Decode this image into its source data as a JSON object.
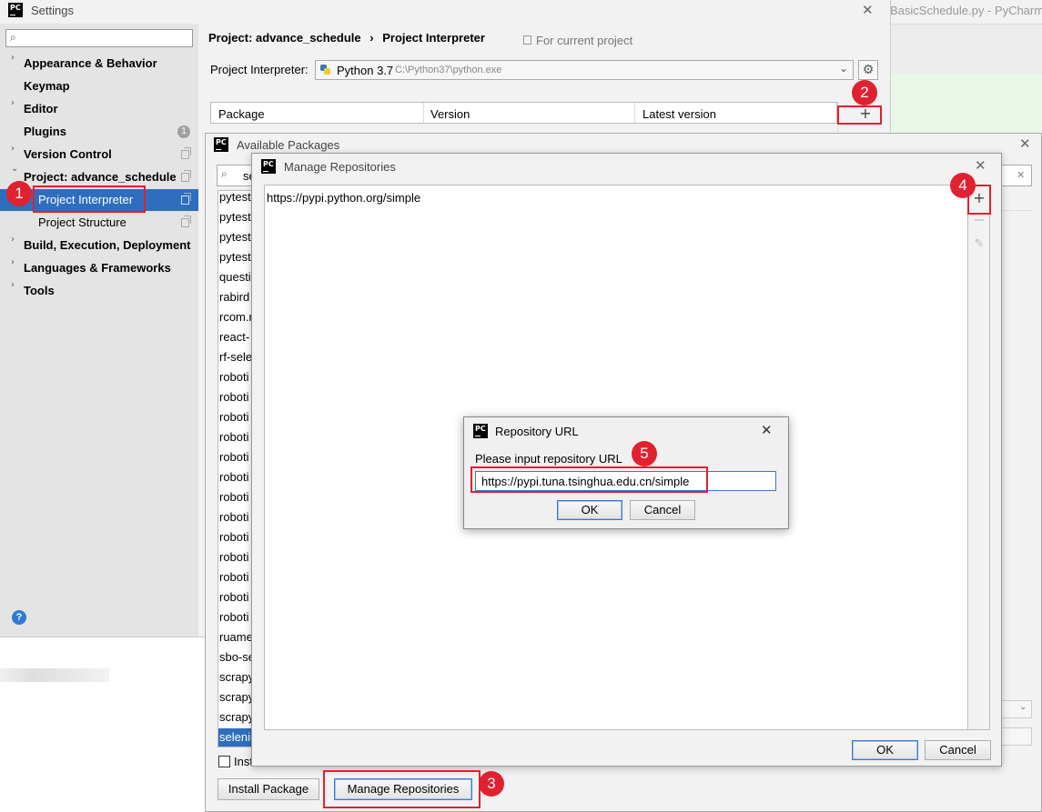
{
  "pycharm_bg": {
    "title": "BasicSchedule.py - PyCharm"
  },
  "settings": {
    "title": "Settings",
    "breadcrumb_project": "Project: advance_schedule",
    "breadcrumb_sep": "›",
    "breadcrumb_page": "Project Interpreter",
    "for_current_project": "For current project",
    "interpreter_label": "Project Interpreter:",
    "interpreter_name": "Python 3.7",
    "interpreter_path": "C:\\Python37\\python.exe",
    "table_headers": [
      "Package",
      "Version",
      "Latest version"
    ],
    "plugins_count": "1",
    "sidebar": [
      {
        "label": "Appearance & Behavior",
        "arrow": "›",
        "bold": true
      },
      {
        "label": "Keymap",
        "arrow": "",
        "bold": true
      },
      {
        "label": "Editor",
        "arrow": "›",
        "bold": true
      },
      {
        "label": "Plugins",
        "arrow": "",
        "bold": true
      },
      {
        "label": "Version Control",
        "arrow": "›",
        "bold": true
      },
      {
        "label": "Project: advance_schedule",
        "arrow": "⌄",
        "bold": true
      },
      {
        "label": "Project Interpreter",
        "arrow": "",
        "bold": false
      },
      {
        "label": "Project Structure",
        "arrow": "",
        "bold": false
      },
      {
        "label": "Build, Execution, Deployment",
        "arrow": "›",
        "bold": true
      },
      {
        "label": "Languages & Frameworks",
        "arrow": "›",
        "bold": true
      },
      {
        "label": "Tools",
        "arrow": "›",
        "bold": true
      }
    ]
  },
  "available_packages": {
    "title": "Available Packages",
    "search_value": "se",
    "packages": [
      "pytest",
      "pytest",
      "pytest",
      "pytest",
      "questi",
      "rabird",
      "rcom.r",
      "react-",
      "rf-sele",
      "roboti",
      "roboti",
      "roboti",
      "roboti",
      "roboti",
      "roboti",
      "roboti",
      "roboti",
      "roboti",
      "roboti",
      "roboti",
      "roboti",
      "roboti",
      "ruame",
      "sbo-se",
      "scrapy",
      "scrapy",
      "scrapy",
      "seleniu"
    ],
    "install_checkbox_label": "Inst",
    "install_button": "Install Package",
    "manage_button": "Manage Repositories"
  },
  "manage_repos": {
    "title": "Manage Repositories",
    "repos": [
      "https://pypi.python.org/simple"
    ],
    "ok": "OK",
    "cancel": "Cancel"
  },
  "repo_url": {
    "title": "Repository URL",
    "prompt": "Please input repository URL",
    "value": "https://pypi.tuna.tsinghua.edu.cn/simple",
    "ok": "OK",
    "cancel": "Cancel"
  },
  "markers": [
    "1",
    "2",
    "3",
    "4",
    "5"
  ]
}
